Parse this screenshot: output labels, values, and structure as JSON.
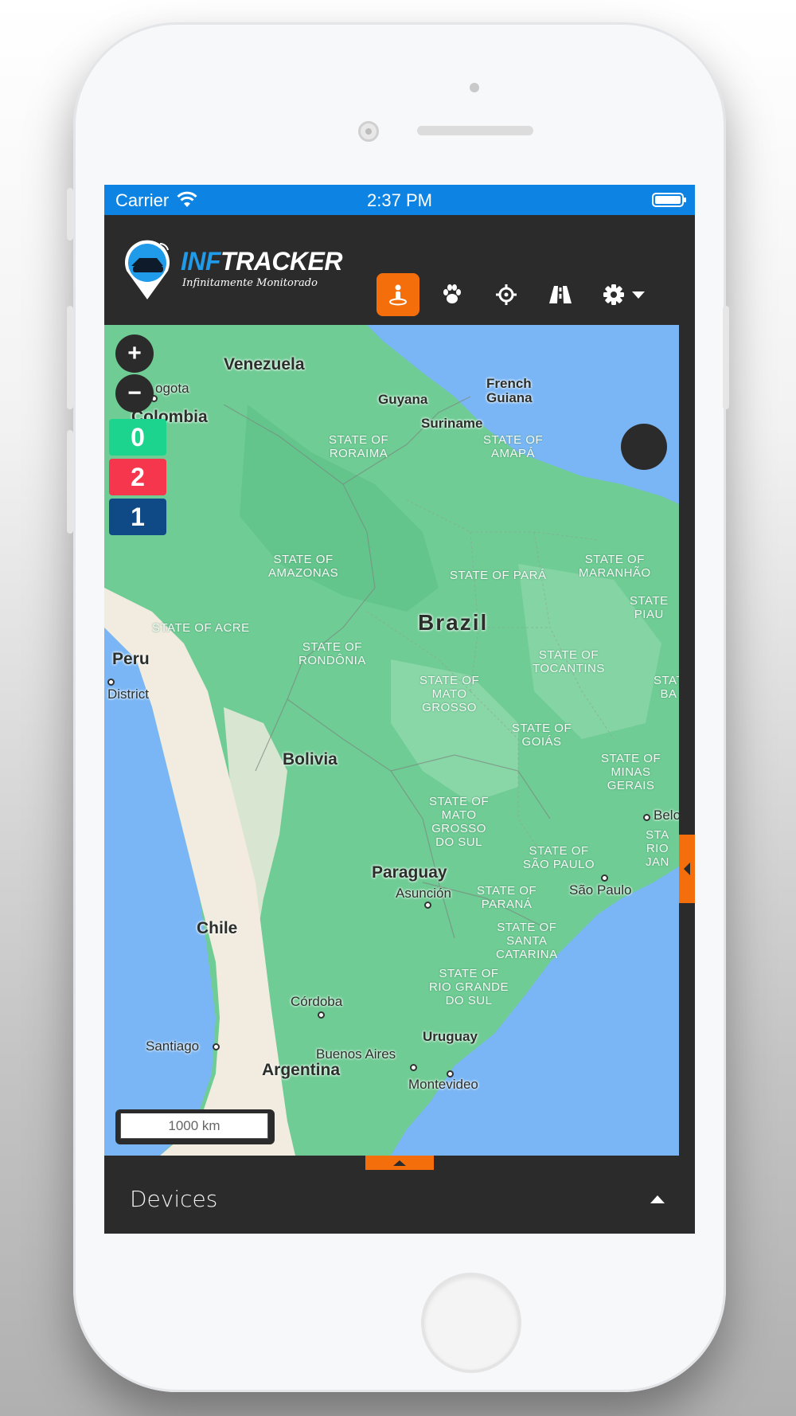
{
  "status_bar": {
    "carrier": "Carrier",
    "time": "2:37 PM"
  },
  "header": {
    "logo_primary": "INF",
    "logo_secondary": "TRACKER",
    "logo_tagline": "Infinitamente Monitorado",
    "nav_icons": [
      "person-location-icon",
      "paw-icon",
      "crosshair-icon",
      "road-icon",
      "gear-icon",
      "caret-down-icon"
    ],
    "active_icon": "person-location-icon",
    "accent_color": "#f46f0c"
  },
  "map": {
    "zoom_in": "+",
    "zoom_out": "−",
    "scale_label": "1000 km",
    "status_counts": [
      {
        "value": "0",
        "color": "#1dd48e"
      },
      {
        "value": "2",
        "color": "#f6364c"
      },
      {
        "value": "1",
        "color": "#0f4a86"
      }
    ],
    "labels": {
      "venezuela": "Venezuela",
      "bogota": "ogota",
      "colombia": "Colombia",
      "guyana": "Guyana",
      "french_guiana_1": "French",
      "french_guiana_2": "Guiana",
      "suriname": "Suriname",
      "roraima": "STATE OF\nRORAIMA",
      "amapa": "STATE OF\nAMAPÁ",
      "amazonas": "STATE OF\nAMAZONAS",
      "para": "STATE OF PARÁ",
      "maranhao": "STATE OF\nMARANHÃO",
      "piaui": "STATE\nPIAU",
      "acre": "STATE OF ACRE",
      "brazil": "Brazil",
      "peru": "Peru",
      "district": "District",
      "rondonia": "STATE OF\nRONDÔNIA",
      "mato_grosso": "STATE OF\nMATO\nGROSSO",
      "tocantins": "STATE OF\nTOCANTINS",
      "bahia": "STAT\nBA",
      "goias": "STATE OF\nGOIÁS",
      "minas": "STATE OF\nMINAS\nGERAIS",
      "bolivia": "Bolivia",
      "mato_grosso_sul": "STATE OF\nMATO\nGROSSO\nDO SUL",
      "belo": "Belo",
      "rio": "STA\nRIO\nJAN",
      "sao_paulo_state": "STATE OF\nSÃO PAULO",
      "sao_paulo": "São Paulo",
      "paraguay": "Paraguay",
      "asuncion": "Asunción",
      "parana": "STATE OF\nPARANÁ",
      "chile": "Chile",
      "santa_catarina": "STATE OF\nSANTA\nCATARINA",
      "rio_grande": "STATE OF\nRIO GRANDE\nDO SUL",
      "cordoba": "Córdoba",
      "uruguay": "Uruguay",
      "santiago": "Santiago",
      "buenos_aires": "Buenos Aires",
      "argentina": "Argentina",
      "montevideo": "Montevideo"
    }
  },
  "panel": {
    "title": "Devices"
  }
}
